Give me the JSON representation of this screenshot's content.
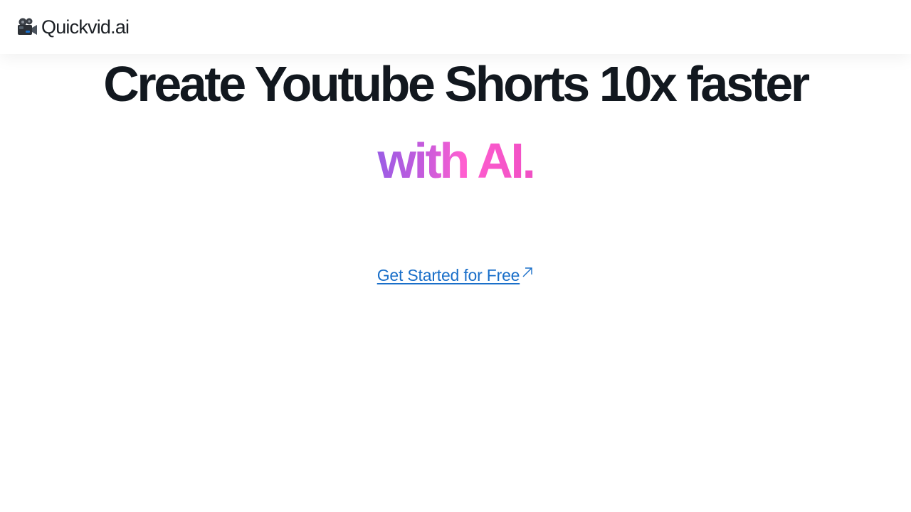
{
  "nav": {
    "brand_name": "Quickvid.ai",
    "brand_icon": "movie-camera-icon"
  },
  "hero": {
    "headline": "Create Youtube Shorts 10x faster",
    "subline": "with AI.",
    "gradient_colors": [
      "#9b5de5",
      "#ff5fd0"
    ]
  },
  "cta": {
    "label": "Get Started for Free",
    "icon": "external-link-arrow-icon"
  },
  "colors": {
    "link": "#1a6fc9",
    "text": "#12181f",
    "background": "#ffffff"
  }
}
